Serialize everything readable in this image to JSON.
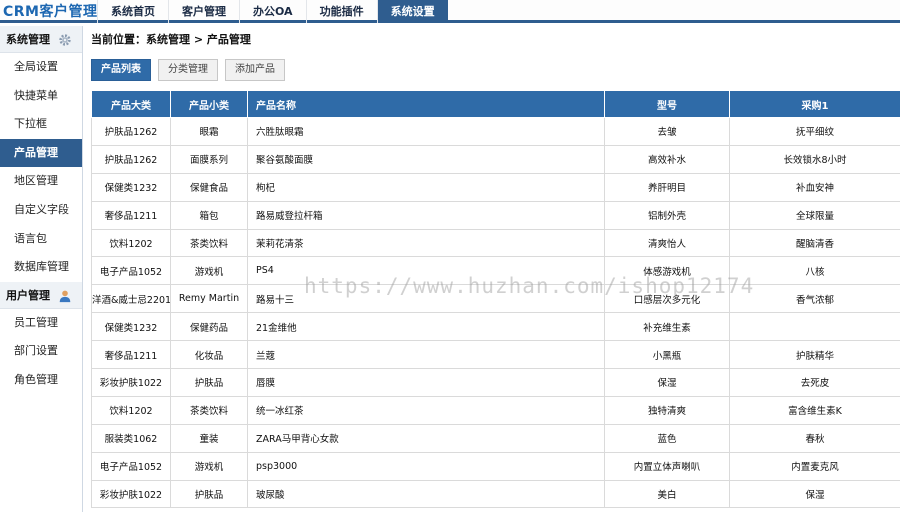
{
  "app": {
    "title": "CRM客户管理"
  },
  "nav": [
    "系统首页",
    "客户管理",
    "办公OA",
    "功能插件",
    "系统设置"
  ],
  "sidebar": {
    "group1": {
      "title": "系统管理",
      "icon": "gear-icon"
    },
    "items1": [
      "全局设置",
      "快捷菜单",
      "下拉框",
      "产品管理",
      "地区管理",
      "自定义字段",
      "语言包",
      "数据库管理"
    ],
    "group2": {
      "title": "用户管理",
      "icon": "user-icon"
    },
    "items2": [
      "员工管理",
      "部门设置",
      "角色管理"
    ]
  },
  "breadcrumb": "当前位置：系统管理 > 产品管理",
  "tabs": [
    "产品列表",
    "分类管理",
    "添加产品"
  ],
  "table": {
    "headers": [
      "产品大类",
      "产品小类",
      "产品名称",
      "型号",
      "采购1"
    ],
    "rows": [
      [
        "护肤品1262",
        "眼霜",
        "六胜肽眼霜",
        "去皱",
        "抚平细纹"
      ],
      [
        "护肤品1262",
        "面膜系列",
        "聚谷氨酸面膜",
        "高效补水",
        "长效锁水8小时"
      ],
      [
        "保健类1232",
        "保健食品",
        "枸杞",
        "养肝明目",
        "补血安神"
      ],
      [
        "奢侈品1211",
        "箱包",
        "路易威登拉杆箱",
        "铝制外壳",
        "全球限量"
      ],
      [
        "饮料1202",
        "茶类饮料",
        "茉莉花清茶",
        "清爽怡人",
        "醒脑清香"
      ],
      [
        "电子产品1052",
        "游戏机",
        "PS4",
        "体感游戏机",
        "八核"
      ],
      [
        "洋酒&威士忌2201",
        "Remy Martin",
        "路易十三",
        "口感层次多元化",
        "香气浓郁"
      ],
      [
        "保健类1232",
        "保健药品",
        "21金维他",
        "补充维生素",
        ""
      ],
      [
        "奢侈品1211",
        "化妆品",
        "兰蔻",
        "小黑瓶",
        "护肤精华"
      ],
      [
        "彩妆护肤1022",
        "护肤品",
        "唇膜",
        "保湿",
        "去死皮"
      ],
      [
        "饮料1202",
        "茶类饮料",
        "统一冰红茶",
        "独特清爽",
        "富含维生素K"
      ],
      [
        "服装类1062",
        "童装",
        "ZARA马甲背心女款",
        "蓝色",
        "春秋"
      ],
      [
        "电子产品1052",
        "游戏机",
        "psp3000",
        "内置立体声喇叭",
        "内置麦克风"
      ],
      [
        "彩妆护肤1022",
        "护肤品",
        "玻尿酸",
        "美白",
        "保湿"
      ]
    ]
  },
  "watermark": "https://www.huzhan.com/ishop12174",
  "colors": {
    "accent": "#2f6ba8",
    "nav_active": "#2f5d8f",
    "logo": "#1d67b1"
  }
}
